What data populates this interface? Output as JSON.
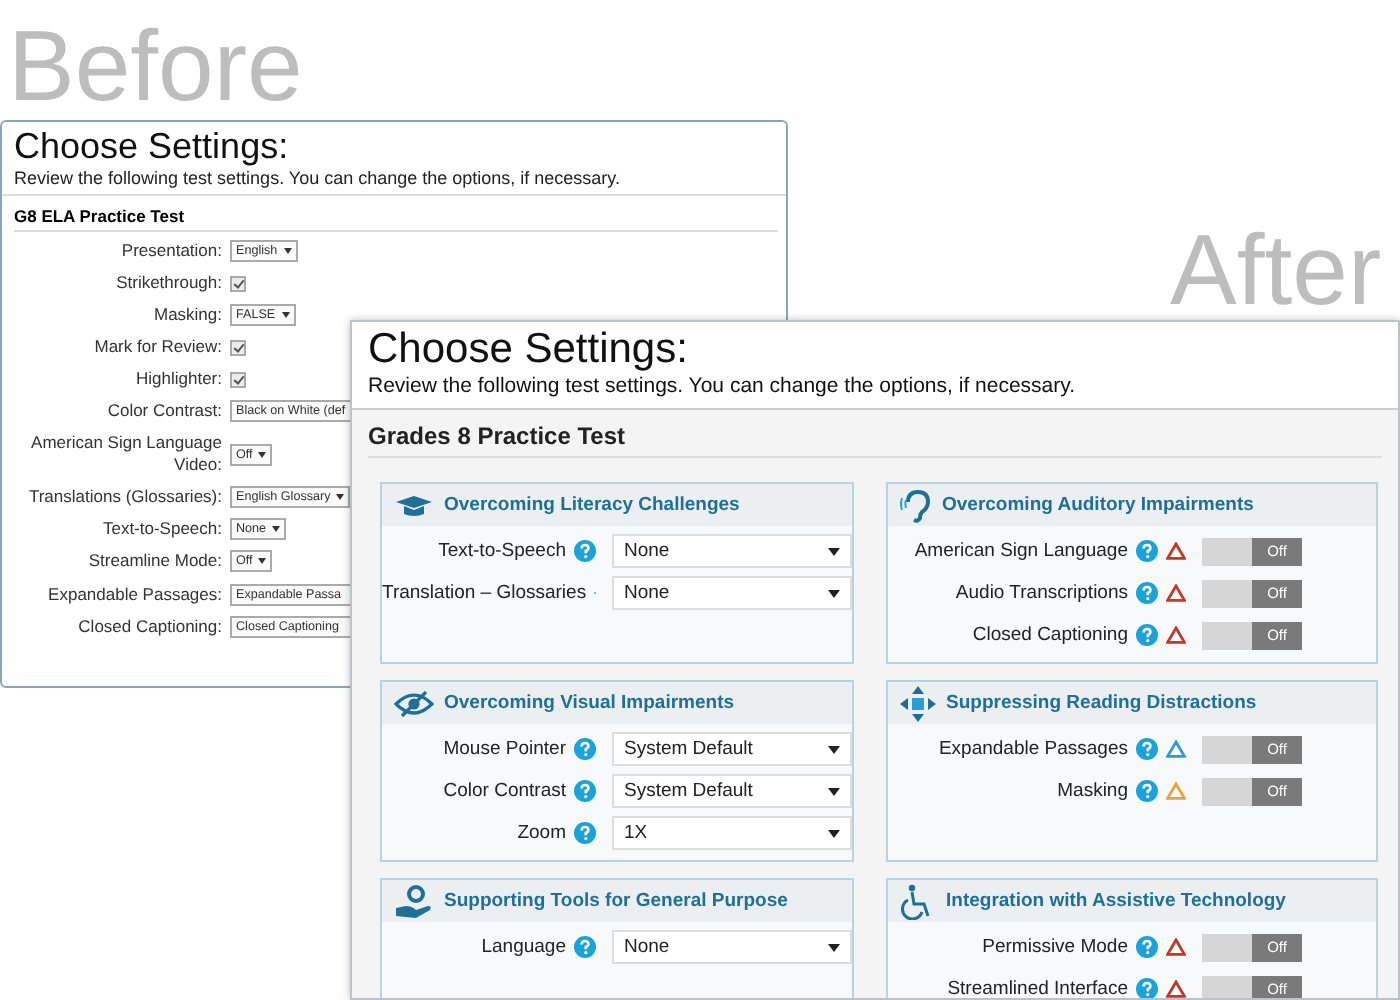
{
  "captions": {
    "before": "Before",
    "after": "After"
  },
  "before": {
    "title": "Choose Settings:",
    "subtitle": "Review the following test settings. You can change the options, if necessary.",
    "test_name": "G8 ELA Practice Test",
    "rows": [
      {
        "label": "Presentation:",
        "kind": "select",
        "value": "English",
        "cut": false
      },
      {
        "label": "Strikethrough:",
        "kind": "checkbox",
        "checked": true
      },
      {
        "label": "Masking:",
        "kind": "select",
        "value": "FALSE",
        "cut": false
      },
      {
        "label": "Mark for Review:",
        "kind": "checkbox",
        "checked": true
      },
      {
        "label": "Highlighter:",
        "kind": "checkbox",
        "checked": true
      },
      {
        "label": "Color Contrast:",
        "kind": "select",
        "value": "Black on White (def",
        "cut": true
      },
      {
        "label": "American Sign Language Video:",
        "kind": "select",
        "value": "Off",
        "cut": false
      },
      {
        "label": "Translations (Glossaries):",
        "kind": "select",
        "value": "English Glossary",
        "cut": false
      },
      {
        "label": "Text-to-Speech:",
        "kind": "select",
        "value": "None",
        "cut": false
      },
      {
        "label": "Streamline Mode:",
        "kind": "select",
        "value": "Off",
        "cut": false
      },
      {
        "label": "Expandable Passages:",
        "kind": "select",
        "value": "Expandable Passa",
        "cut": true
      },
      {
        "label": "Closed Captioning:",
        "kind": "select",
        "value": "Closed Captioning",
        "cut": true
      }
    ]
  },
  "after": {
    "title": "Choose Settings:",
    "subtitle": "Review the following test settings. You can change the options, if necessary.",
    "test_name": "Grades 8 Practice Test",
    "panels": [
      {
        "title": "Overcoming Literacy Challenges",
        "rows": [
          {
            "label": "Text-to-Speech",
            "kind": "select",
            "value": "None"
          },
          {
            "label": "Translation – Glossaries",
            "kind": "select",
            "value": "None"
          }
        ]
      },
      {
        "title": "Overcoming Auditory Impairments",
        "rows": [
          {
            "label": "American Sign Language",
            "kind": "toggle",
            "color": "#c0392b",
            "on": false,
            "state": "Off"
          },
          {
            "label": "Audio Transcriptions",
            "kind": "toggle",
            "color": "#c0392b",
            "on": false,
            "state": "Off"
          },
          {
            "label": "Closed Captioning",
            "kind": "toggle",
            "color": "#c0392b",
            "on": false,
            "state": "Off"
          }
        ]
      },
      {
        "title": "Overcoming Visual Impairments",
        "rows": [
          {
            "label": "Mouse Pointer",
            "kind": "select",
            "value": "System Default"
          },
          {
            "label": "Color Contrast",
            "kind": "select",
            "value": "System Default"
          },
          {
            "label": "Zoom",
            "kind": "select",
            "value": "1X"
          }
        ]
      },
      {
        "title": "Suppressing Reading Distractions",
        "rows": [
          {
            "label": "Expandable Passages",
            "kind": "toggle",
            "color": "#2a9fd6",
            "on": false,
            "state": "Off"
          },
          {
            "label": "Masking",
            "kind": "toggle",
            "color": "#e8a33c",
            "on": false,
            "state": "Off"
          }
        ]
      },
      {
        "title": "Supporting Tools for General Purpose",
        "rows": [
          {
            "label": "Language",
            "kind": "select",
            "value": "None"
          }
        ]
      },
      {
        "title": "Integration with Assistive Technology",
        "rows": [
          {
            "label": "Permissive Mode",
            "kind": "toggle",
            "color": "#c0392b",
            "on": false,
            "state": "Off"
          },
          {
            "label": "Streamlined Interface",
            "kind": "toggle",
            "color": "#c0392b",
            "on": false,
            "state": "Off"
          }
        ]
      }
    ]
  }
}
